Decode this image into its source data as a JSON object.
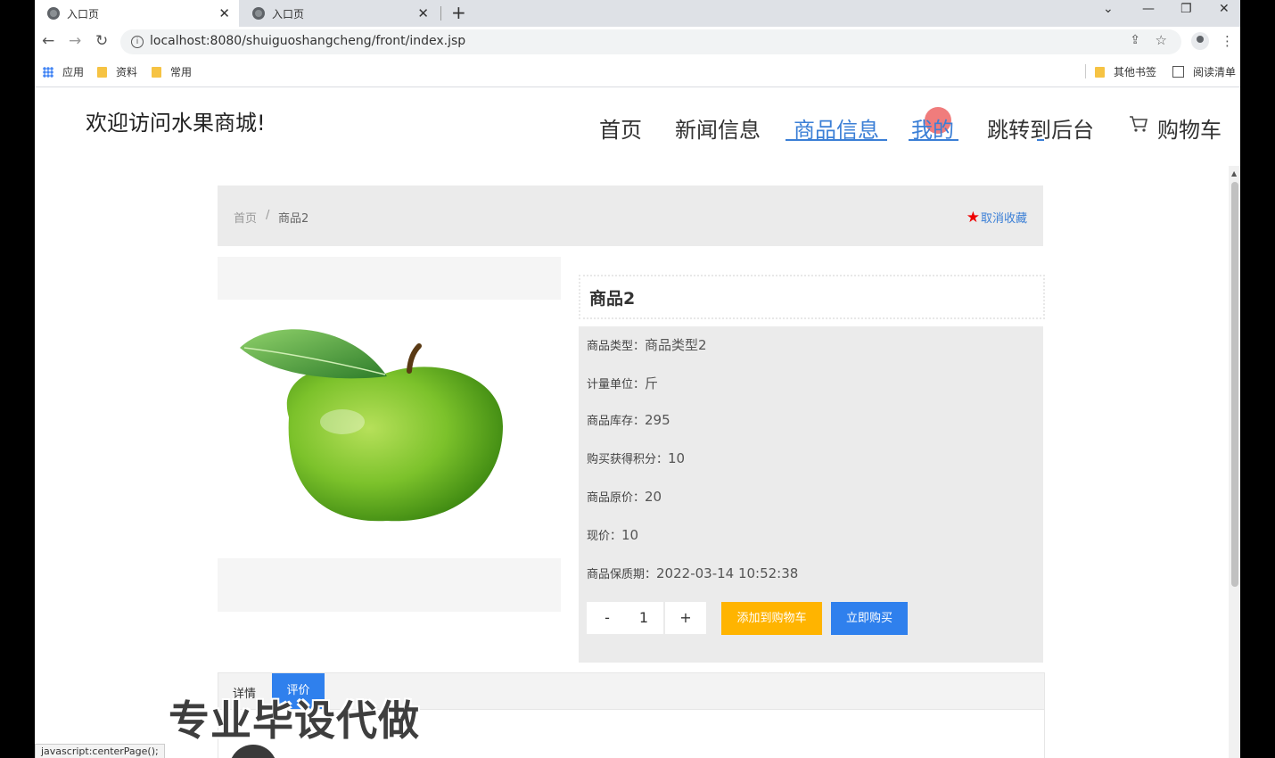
{
  "browser": {
    "tabs": [
      {
        "label": "入口页",
        "active": true
      },
      {
        "label": "入口页",
        "active": false
      }
    ],
    "url": "localhost:8080/shuiguoshangcheng/front/index.jsp",
    "bookmarks": [
      {
        "label": "应用",
        "icon": "apps-icon"
      },
      {
        "label": "资料",
        "icon": "folder-icon"
      },
      {
        "label": "常用",
        "icon": "folder-icon"
      }
    ],
    "bookmarks_right": [
      {
        "label": "其他书签",
        "icon": "folder-icon"
      },
      {
        "label": "阅读清单",
        "icon": "reading-list-icon"
      }
    ],
    "status_text": "javascript:centerPage();"
  },
  "header": {
    "welcome": "欢迎访问水果商城!",
    "nav": [
      {
        "label": "首页",
        "active": false
      },
      {
        "label": "新闻信息",
        "active": false
      },
      {
        "label": "商品信息",
        "active": true
      },
      {
        "label": "我的",
        "active": false
      },
      {
        "label": "跳转到后台",
        "active": false
      },
      {
        "label": "购物车",
        "active": false,
        "icon": "cart-icon"
      }
    ]
  },
  "breadcrumb": {
    "home": "首页",
    "separator": "/",
    "current": "商品2"
  },
  "favorite": {
    "label": "取消收藏",
    "icon": "star-icon",
    "icon_color": "#e00000"
  },
  "product": {
    "name": "商品2",
    "image": "green-apple",
    "fields": [
      {
        "key": "商品类型：",
        "value": "商品类型2"
      },
      {
        "key": "计量单位：",
        "value": "斤"
      },
      {
        "key": "商品库存：",
        "value": "295"
      },
      {
        "key": "购买获得积分：",
        "value": "10"
      },
      {
        "key": "商品原价：",
        "value": "20"
      },
      {
        "key": "现价：",
        "value": "10"
      },
      {
        "key": "商品保质期：",
        "value": "2022-03-14 10:52:38"
      }
    ],
    "quantity": {
      "minus": "-",
      "value": "1",
      "plus": "+"
    },
    "add_to_cart": "添加到购物车",
    "buy_now": "立即购买"
  },
  "detail_tabs": [
    {
      "label": "详情",
      "active": false
    },
    {
      "label": "评价",
      "active": true
    }
  ],
  "watermark": "专业毕设代做",
  "colors": {
    "accent": "#3b7fd6",
    "cart_button": "#ffb400",
    "buy_button": "#2f80ed"
  }
}
